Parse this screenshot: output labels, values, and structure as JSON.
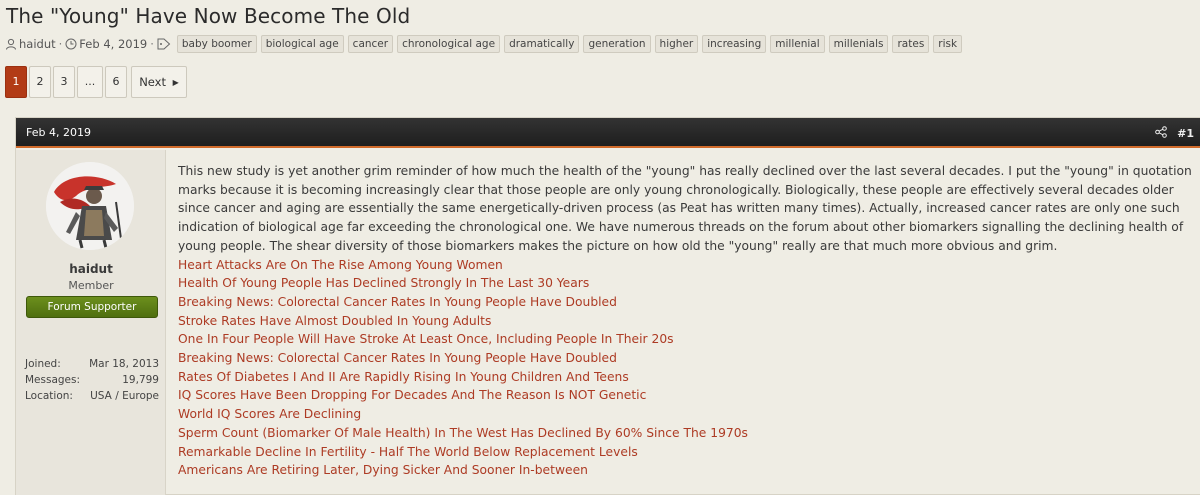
{
  "thread": {
    "title": "The \"Young\" Have Now Become The Old",
    "author": "haidut",
    "date": "Feb 4, 2019",
    "tags": [
      "baby boomer",
      "biological age",
      "cancer",
      "chronological age",
      "dramatically",
      "generation",
      "higher",
      "increasing",
      "millenial",
      "millenials",
      "rates",
      "risk"
    ]
  },
  "pagination": {
    "pages": [
      "1",
      "2",
      "3",
      "...",
      "6"
    ],
    "active": "1",
    "next_label": "Next"
  },
  "post": {
    "date": "Feb 4, 2019",
    "number": "#1",
    "author": {
      "name": "haidut",
      "title": "Member",
      "banner": "Forum Supporter",
      "joined_label": "Joined:",
      "joined": "Mar 18, 2013",
      "messages_label": "Messages:",
      "messages": "19,799",
      "location_label": "Location:",
      "location": "USA / Europe"
    },
    "body": "This new study is yet another grim reminder of how much the health of the \"young\" has really declined over the last several decades. I put the \"young\" in quotation marks because it is becoming increasingly clear that those people are only young chronologically. Biologically, these people are effectively several decades older since cancer and aging are essentially the same energetically-driven process (as Peat has written many times). Actually, increased cancer rates are only one such indication of biological age far exceeding the chronological one. We have numerous threads on the forum about other biomarkers signalling the declining health of young people. The shear diversity of those biomarkers makes the picture on how old the \"young\" really are that much more obvious and grim.",
    "links": [
      "Heart Attacks Are On The Rise Among Young Women",
      "Health Of Young People Has Declined Strongly In The Last 30 Years",
      "Breaking News: Colorectal Cancer Rates In Young People Have Doubled",
      "Stroke Rates Have Almost Doubled In Young Adults",
      "One In Four People Will Have Stroke At Least Once, Including People In Their 20s",
      "Breaking News: Colorectal Cancer Rates In Young People Have Doubled",
      "Rates Of Diabetes I And II Are Rapidly Rising In Young Children And Teens",
      "IQ Scores Have Been Dropping For Decades And The Reason Is NOT Genetic",
      "World IQ Scores Are Declining",
      "Sperm Count (Biomarker Of Male Health) In The West Has Declined By 60% Since The 1970s",
      "Remarkable Decline In Fertility - Half The World Below Replacement Levels",
      "Americans Are Retiring Later, Dying Sicker And Sooner In-between"
    ]
  },
  "colors": {
    "accent": "#b23b16",
    "link": "#ad3b24",
    "banner": "#5a7d14",
    "header": "#262626"
  }
}
